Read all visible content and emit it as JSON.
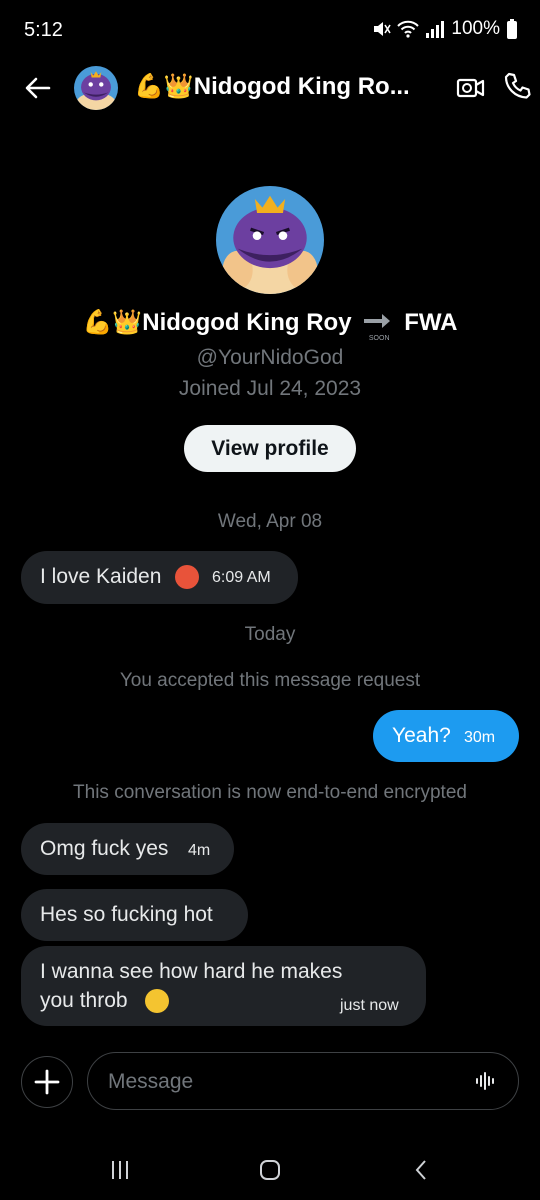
{
  "status_bar": {
    "time": "5:12",
    "battery": "100%"
  },
  "header": {
    "title": "💪👑Nidogod King Ro..."
  },
  "profile": {
    "name": "💪👑Nidogod King Roy",
    "name_suffix": "FWA",
    "soon_label": "SOON",
    "handle": "@YourNidoGod",
    "joined": "Joined Jul 24, 2023",
    "view_profile_label": "View profile"
  },
  "conversation": {
    "date_1": "Wed, Apr 08",
    "date_2": "Today",
    "system_1": "You accepted this message request",
    "system_2": "This conversation is now end-to-end encrypted",
    "messages": [
      {
        "dir": "in",
        "text": "I love Kaiden",
        "time": "6:09 AM"
      },
      {
        "dir": "out",
        "text": "Yeah?",
        "time": "30m"
      },
      {
        "dir": "in",
        "text": "Omg fuck yes",
        "time": "4m"
      },
      {
        "dir": "in",
        "text": "Hes so fucking hot",
        "time": ""
      },
      {
        "dir": "in",
        "text_line1": "I wanna see how hard he makes",
        "text_line2": "you throb",
        "time": "just now"
      }
    ]
  },
  "composer": {
    "placeholder": "Message"
  },
  "icons": {
    "back": "arrow-left-icon",
    "video": "video-call-icon",
    "phone": "phone-icon",
    "plus": "plus-icon",
    "voice": "voice-waveform-icon",
    "nav_recents": "recents-icon",
    "nav_home": "home-icon",
    "nav_back": "nav-back-icon"
  },
  "colors": {
    "accent": "#1d9bf0",
    "bubble_in": "#202327",
    "muted": "#71767b",
    "background": "#000000"
  }
}
